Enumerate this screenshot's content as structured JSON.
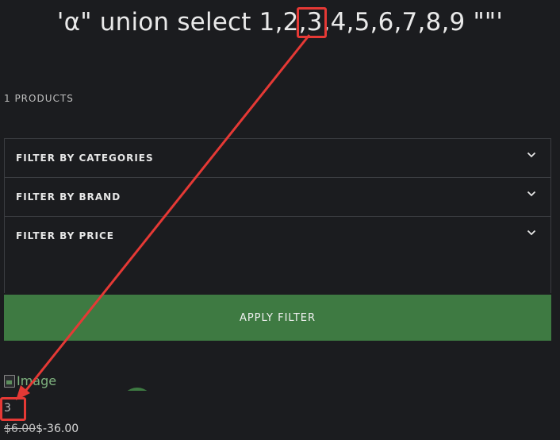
{
  "header": {
    "title": "'α\" union select 1,2,3,4,5,6,7,8,9 \"\"'"
  },
  "listing": {
    "products_count": "1 PRODUCTS"
  },
  "filters": {
    "items": [
      {
        "label": "FILTER BY CATEGORIES",
        "icon": "chevron-down-icon"
      },
      {
        "label": "FILTER BY BRAND",
        "icon": "chevron-down-icon"
      },
      {
        "label": "FILTER BY PRICE",
        "icon": "chevron-down-icon"
      }
    ],
    "apply_label": "APPLY FILTER"
  },
  "product": {
    "image_alt": "Image",
    "name": "3",
    "price_old": "$6.00",
    "price_new": "$-36.00"
  },
  "colors": {
    "background": "#1b1c1f",
    "accent": "#3e7a42",
    "annotation": "#e53935"
  }
}
